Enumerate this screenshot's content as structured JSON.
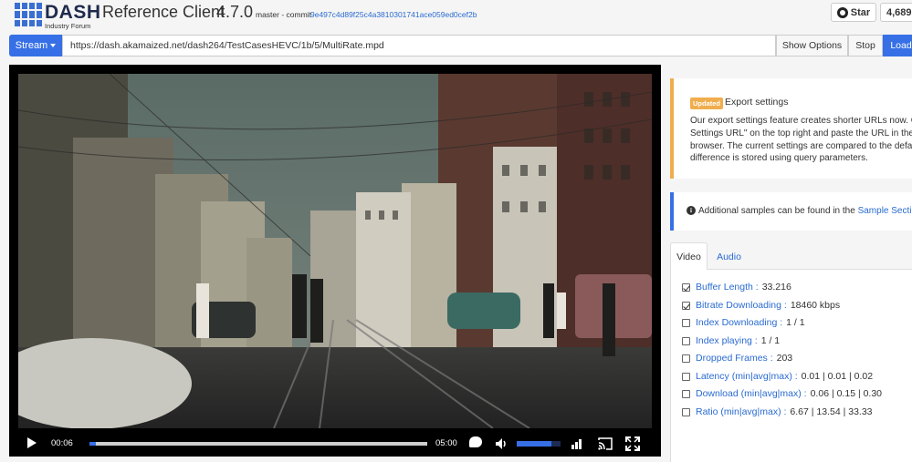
{
  "header": {
    "logo_text": "DASH",
    "logo_subtext": "Industry Forum",
    "title": "Reference Client",
    "version": "4.7.0",
    "branch": "master - commit",
    "commit_hash": "9e497c4d89f25c4a3810301741ace059ed0cef2b",
    "star_label": "Star",
    "star_count": "4,689"
  },
  "toolbar": {
    "stream_label": "Stream",
    "url_value": "https://dash.akamaized.net/dash264/TestCasesHEVC/1b/5/MultiRate.mpd",
    "show_options_label": "Show Options",
    "stop_label": "Stop",
    "load_label": "Load"
  },
  "player": {
    "current_time": "00:06",
    "duration": "05:00",
    "progress_fraction": 0.02,
    "volume_fraction": 0.8
  },
  "notice": {
    "badge": "Updated",
    "title": "Export settings",
    "body_lines": [
      "Our export settings feature creates shorter URLs now. Cli",
      "Settings URL\" on the top right and paste the URL in the a",
      "browser. The current settings are compared to the default",
      "difference is stored using query parameters."
    ]
  },
  "info": {
    "text": "Additional samples can be found in the",
    "link": "Sample Sectio"
  },
  "tabs": {
    "video": "Video",
    "audio": "Audio"
  },
  "stats": [
    {
      "label": "Buffer Length :",
      "value": "33.216",
      "checked": true
    },
    {
      "label": "Bitrate Downloading :",
      "value": "18460 kbps",
      "checked": true
    },
    {
      "label": "Index Downloading :",
      "value": "1 / 1",
      "checked": false
    },
    {
      "label": "Index playing :",
      "value": "1 / 1",
      "checked": false
    },
    {
      "label": "Dropped Frames :",
      "value": "203",
      "checked": false
    },
    {
      "label": "Latency (min|avg|max) :",
      "value": "0.01 | 0.01 | 0.02",
      "checked": false
    },
    {
      "label": "Download (min|avg|max) :",
      "value": "0.06 | 0.15 | 0.30",
      "checked": false
    },
    {
      "label": "Ratio (min|avg|max) :",
      "value": "6.67 | 13.54 | 33.33",
      "checked": false
    }
  ]
}
